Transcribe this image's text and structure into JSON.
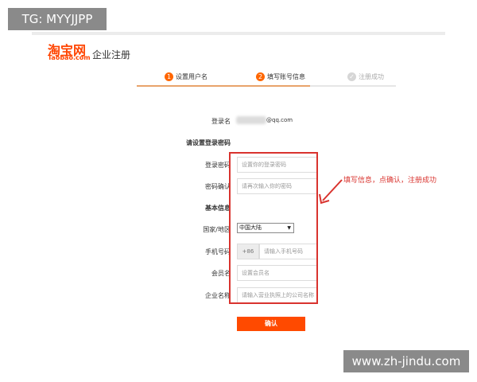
{
  "watermark": {
    "top": "TG: MYYJJPP",
    "bottom": "www.zh-jindu.com"
  },
  "header": {
    "logo_main": "淘宝网",
    "logo_sub": "Taobao.com",
    "title": "企业注册"
  },
  "steps": [
    {
      "num": "1",
      "label": "设置用户名"
    },
    {
      "num": "2",
      "label": "填写账号信息"
    },
    {
      "num": "✓",
      "label": "注册成功"
    }
  ],
  "form": {
    "login_name_label": "登录名",
    "login_name_suffix": "@qq.com",
    "password_section": "请设置登录密码",
    "password_label": "登录密码",
    "password_placeholder": "设置你的登录密码",
    "confirm_label": "密码确认",
    "confirm_placeholder": "请再次输入你的密码",
    "basic_section": "基本信息",
    "region_label": "国家/地区",
    "region_value": "中国大陆",
    "phone_label": "手机号码",
    "phone_prefix": "+86",
    "phone_placeholder": "请输入手机号码",
    "member_label": "会员名",
    "member_placeholder": "设置会员名",
    "company_label": "企业名称",
    "company_placeholder": "请输入营业执照上的公司名称",
    "submit": "确认"
  },
  "annotation": "填写信息，点确认，注册成功",
  "colors": {
    "brand": "#ff4400",
    "annotation": "#d9332e",
    "button": "#ff4a00"
  }
}
